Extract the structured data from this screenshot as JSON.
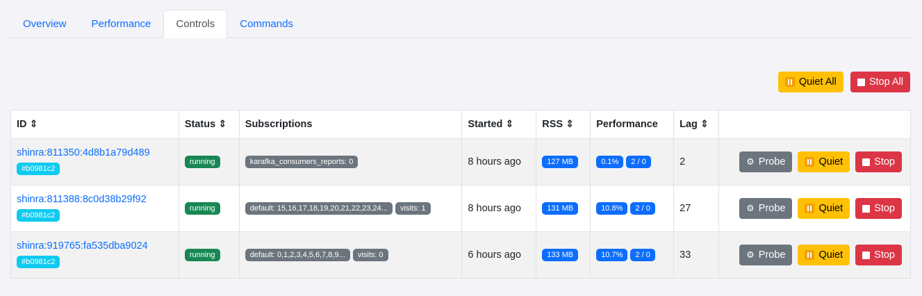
{
  "tabs": [
    "Overview",
    "Performance",
    "Controls",
    "Commands"
  ],
  "active_tab": "Controls",
  "top_actions": {
    "quiet_all": "Quiet All",
    "stop_all": "Stop All"
  },
  "table": {
    "headers": {
      "id": "ID ⇕",
      "status": "Status ⇕",
      "subscriptions": "Subscriptions",
      "started": "Started ⇕",
      "rss": "RSS ⇕",
      "performance": "Performance",
      "lag": "Lag ⇕"
    },
    "rows": [
      {
        "id": "shinra:811350:4d8b1a79d489",
        "tag": "#b0981c2",
        "status": "running",
        "subscriptions": [
          "karafka_consumers_reports: 0"
        ],
        "started": "8 hours ago",
        "rss": "127 MB",
        "cpu": "0.1%",
        "threads": "2 / 0",
        "lag": "2"
      },
      {
        "id": "shinra:811388:8c0d38b29f92",
        "tag": "#b0981c2",
        "status": "running",
        "subscriptions": [
          "default: 15,16,17,18,19,20,21,22,23,24...",
          "visits: 1"
        ],
        "started": "8 hours ago",
        "rss": "131 MB",
        "cpu": "10.8%",
        "threads": "2 / 0",
        "lag": "27"
      },
      {
        "id": "shinra:919765:fa535dba9024",
        "tag": "#b0981c2",
        "status": "running",
        "subscriptions": [
          "default: 0,1,2,3,4,5,6,7,8,9...",
          "visits: 0"
        ],
        "started": "6 hours ago",
        "rss": "133 MB",
        "cpu": "10.7%",
        "threads": "2 / 0",
        "lag": "33"
      }
    ],
    "row_actions": {
      "probe": "Probe",
      "quiet": "Quiet",
      "stop": "Stop"
    }
  },
  "icons": {
    "probe": "gear-icon",
    "quiet": "pause-icon",
    "stop": "stop-icon"
  },
  "colors": {
    "primary": "#0d6efd",
    "warning": "#ffc107",
    "danger": "#dc3545",
    "secondary": "#6c757d",
    "success": "#198754",
    "info": "#0dcaf0"
  }
}
